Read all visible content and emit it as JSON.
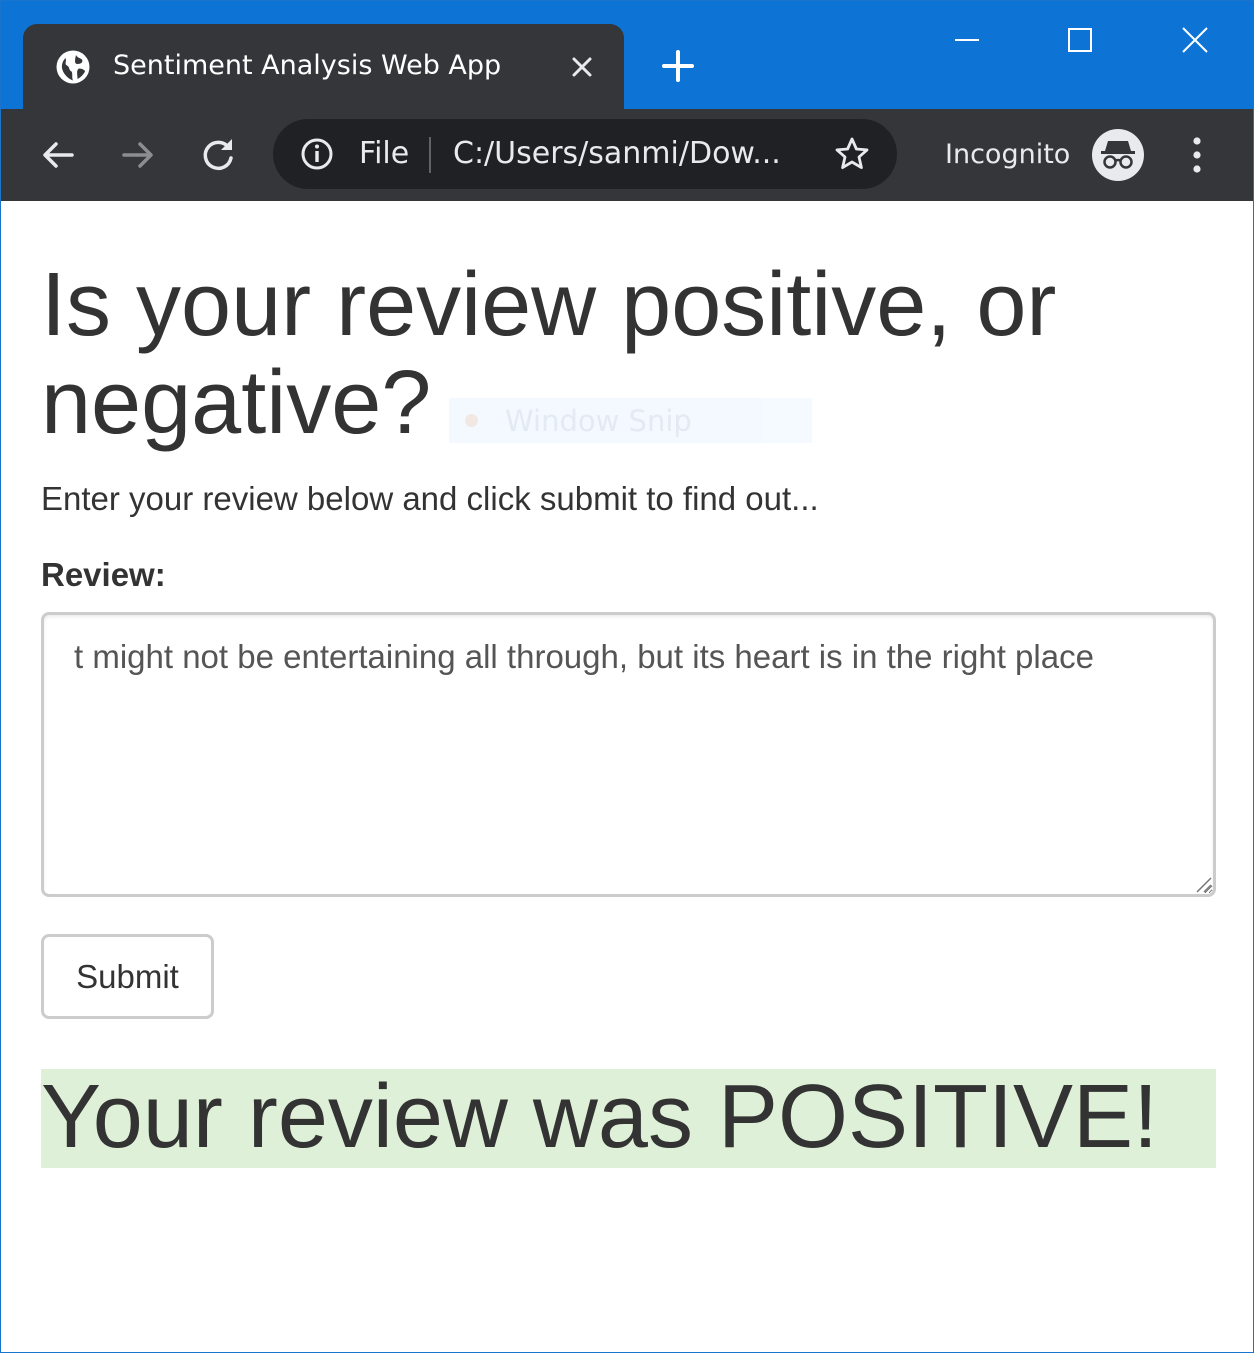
{
  "browser": {
    "tab": {
      "title": "Sentiment Analysis Web App",
      "favicon": "globe-icon"
    },
    "new_tab_icon": "plus-icon",
    "window_controls": [
      "minimize-icon",
      "maximize-icon",
      "close-icon"
    ],
    "toolbar": {
      "back_icon": "arrow-left-icon",
      "forward_icon": "arrow-right-icon",
      "reload_icon": "reload-icon"
    },
    "address_bar": {
      "info_icon": "info-icon",
      "scheme_label": "File",
      "url": "C:/Users/sanmi/Dow...",
      "bookmark_icon": "star-icon"
    },
    "profile": {
      "label": "Incognito",
      "avatar_icon": "incognito-icon"
    },
    "menu_icon": "kebab-menu-icon",
    "colors": {
      "titlebar": "#0d74d6",
      "tab": "#35363a",
      "toolbar": "#35363a",
      "omnibox": "#202124"
    }
  },
  "overlay": {
    "label": "Window Snip"
  },
  "page": {
    "title": "Is your review positive, or negative?",
    "instructions": "Enter your review below and click submit to find out...",
    "review_label": "Review:",
    "review_value": "t might not be entertaining all through, but its heart is in the right place",
    "submit_label": "Submit",
    "result_text": "Your review was POSITIVE!",
    "colors": {
      "text": "#333333",
      "result_background": "#dff0d8"
    }
  }
}
